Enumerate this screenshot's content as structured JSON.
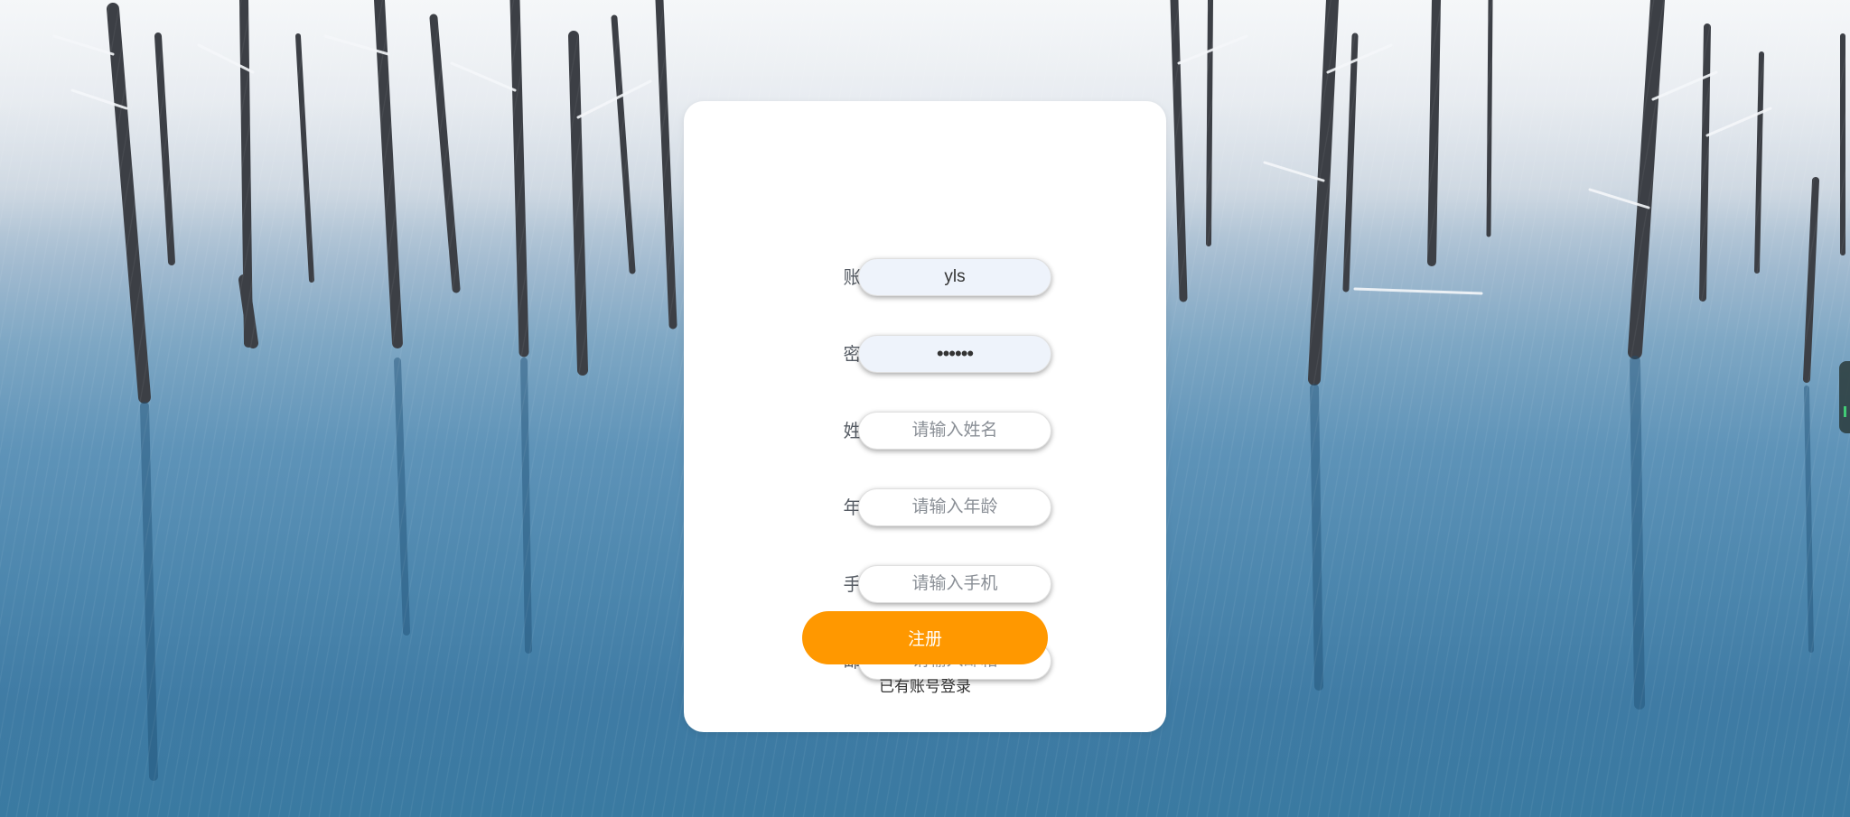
{
  "background": {
    "description_icon": "snowy-forest-lake-background"
  },
  "form": {
    "fields": [
      {
        "label": "账号:",
        "value": "yls",
        "placeholder": "",
        "type": "text"
      },
      {
        "label": "密码:",
        "value": "••••••",
        "placeholder": "",
        "type": "password"
      },
      {
        "label": "姓名:",
        "value": "",
        "placeholder": "请输入姓名",
        "type": "text"
      },
      {
        "label": "年龄:",
        "value": "",
        "placeholder": "请输入年龄",
        "type": "text"
      },
      {
        "label": "手机:",
        "value": "",
        "placeholder": "请输入手机",
        "type": "text"
      },
      {
        "label": "邮箱:",
        "value": "",
        "placeholder": "请输入邮箱",
        "type": "text"
      }
    ],
    "submit_label": "注册",
    "login_link": "已有账号登录"
  },
  "colors": {
    "accent": "#ff9800",
    "card": "#ffffff",
    "filled_field": "#eef3fb"
  }
}
